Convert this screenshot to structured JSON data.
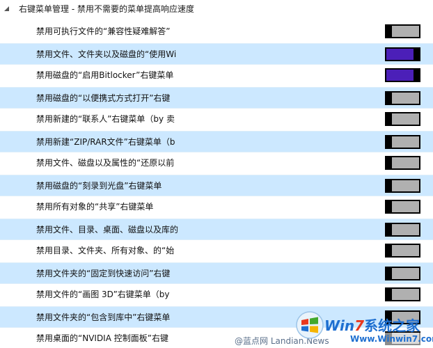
{
  "section": {
    "title": "右键菜单管理 - 禁用不需要的菜单提高响应速度",
    "expanded": true
  },
  "rows": [
    {
      "label": "禁用可执行文件的“兼容性疑难解答”",
      "state": "off"
    },
    {
      "label": "禁用文件、文件夹以及磁盘的“使用Wi",
      "state": "on"
    },
    {
      "label": "禁用磁盘的“启用Bitlocker”右键菜单",
      "state": "on"
    },
    {
      "label": "禁用磁盘的“以便携式方式打开”右键",
      "state": "off"
    },
    {
      "label": "禁用新建的“联系人”右键菜单（by 卖",
      "state": "off"
    },
    {
      "label": "禁用新建“ZIP/RAR文件”右键菜单（b",
      "state": "off"
    },
    {
      "label": "禁用文件、磁盘以及属性的“还原以前",
      "state": "off"
    },
    {
      "label": "禁用磁盘的“刻录到光盘”右键菜单",
      "state": "off"
    },
    {
      "label": "禁用所有对象的“共享”右键菜单",
      "state": "off"
    },
    {
      "label": "禁用文件、目录、桌面、磁盘以及库的",
      "state": "off"
    },
    {
      "label": "禁用目录、文件夹、所有对象、的“始",
      "state": "off"
    },
    {
      "label": "禁用文件夹的“固定到快速访问”右键",
      "state": "off"
    },
    {
      "label": "禁用文件的“画图 3D”右键菜单（by",
      "state": "off"
    },
    {
      "label": "禁用文件夹的“包含到库中”右键菜单",
      "state": "off"
    },
    {
      "label": "禁用桌面的“NVIDIA 控制面板”右键",
      "state": "off"
    }
  ],
  "watermark": {
    "text": "@蓝点网 Landian.News",
    "brand_w": "Win",
    "brand_7": "7",
    "brand_cn": "系统之家",
    "url": "Www.Winwin7.com"
  },
  "colors": {
    "row_highlight": "#cce8ff",
    "toggle_on": "#4b1fb8",
    "toggle_off": "#b0b0b0"
  }
}
